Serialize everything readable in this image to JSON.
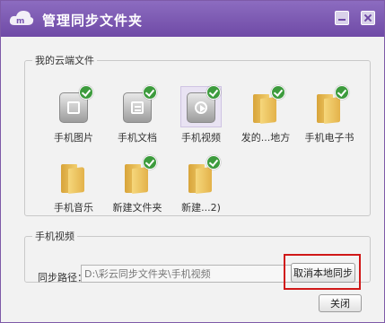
{
  "window": {
    "title": "管理同步文件夹"
  },
  "cloud_files": {
    "legend": "我的云端文件",
    "items": [
      {
        "label": "手机图片",
        "icon": "photo-icon",
        "synced": true,
        "selected": false
      },
      {
        "label": "手机文档",
        "icon": "document-icon",
        "synced": true,
        "selected": false
      },
      {
        "label": "手机视频",
        "icon": "video-icon",
        "synced": true,
        "selected": true
      },
      {
        "label": "发的...地方",
        "icon": "folder-icon",
        "synced": true,
        "selected": false
      },
      {
        "label": "手机电子书",
        "icon": "folder-icon",
        "synced": true,
        "selected": false
      },
      {
        "label": "手机音乐",
        "icon": "folder-icon",
        "synced": false,
        "selected": false
      },
      {
        "label": "新建文件夹",
        "icon": "folder-icon",
        "synced": true,
        "selected": false
      },
      {
        "label": "新建...2)",
        "icon": "folder-icon",
        "synced": true,
        "selected": false
      }
    ]
  },
  "sync_panel": {
    "legend": "手机视频",
    "path_label": "同步路径：",
    "path_value": "D:\\彩云同步文件夹\\手机视频",
    "cancel_label": "取消本地同步"
  },
  "footer": {
    "close_label": "关闭"
  },
  "colors": {
    "titlebar": "#7b58b3",
    "highlight": "#d01818",
    "check": "#3d9b3d"
  }
}
